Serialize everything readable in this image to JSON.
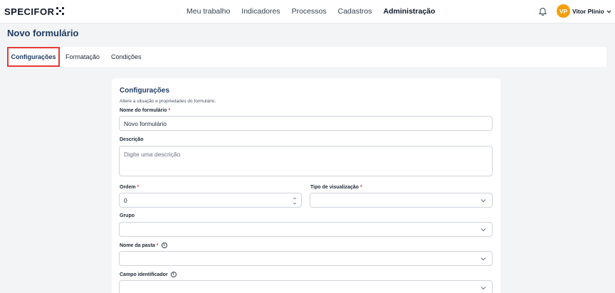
{
  "brand": {
    "name": "SPECIFOR"
  },
  "nav": {
    "items": [
      "Meu trabalho",
      "Indicadores",
      "Processos",
      "Cadastros",
      "Administração"
    ],
    "active_index": 4
  },
  "user": {
    "initials": "VP",
    "name": "Vitor Plinio",
    "avatar_color": "#f59e0b"
  },
  "page": {
    "title": "Novo formulário"
  },
  "tabs": [
    {
      "label": "Configurações",
      "selected": true
    },
    {
      "label": "Formatação",
      "selected": false
    },
    {
      "label": "Condições",
      "selected": false
    }
  ],
  "form": {
    "title": "Configurações",
    "subtitle": "Altere a situação e propriedades do formulário.",
    "name": {
      "label": "Nome do formulário",
      "required_mark": "*",
      "value": "Novo formulário"
    },
    "description": {
      "label": "Descrição",
      "placeholder": "Digite uma descrição"
    },
    "order": {
      "label": "Ordem",
      "required_mark": "*",
      "value": "0"
    },
    "view_type": {
      "label": "Tipo de visualização",
      "required_mark": "*",
      "value": ""
    },
    "group": {
      "label": "Grupo",
      "value": ""
    },
    "folder_name": {
      "label": "Nome da pasta",
      "required_mark": "*",
      "info_icon": "i",
      "value": ""
    },
    "identifier_field": {
      "label": "Campo identificador",
      "info_icon": "i",
      "value": ""
    }
  },
  "colors": {
    "accent": "#1e3a5f",
    "required": "#e53935",
    "highlight_border": "#e53935"
  }
}
